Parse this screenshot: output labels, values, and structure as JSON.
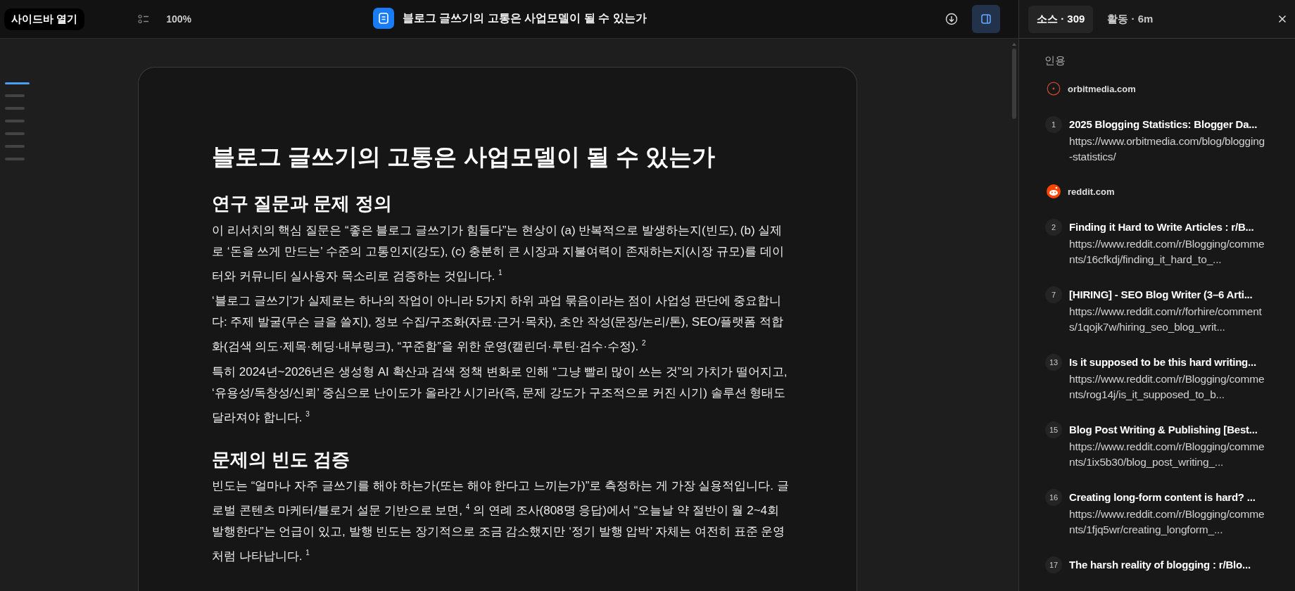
{
  "topbar": {
    "sidebar_button": "사이드바 열기",
    "zoom": "100%",
    "document_title": "블로그 글쓰기의 고통은 사업모델이 될 수 있는가",
    "panel_toggle": {
      "on": true
    }
  },
  "outline": [
    {
      "selected": true
    },
    {
      "selected": false
    },
    {
      "selected": false
    },
    {
      "selected": false
    },
    {
      "selected": false
    },
    {
      "selected": false
    },
    {
      "selected": false
    }
  ],
  "document": [
    {
      "kind": "title",
      "text": "블로그 글쓰기의 고통은 사업모델이 될 수 있는가"
    },
    {
      "kind": "heading",
      "text": "연구 질문과 문제 정의"
    },
    {
      "kind": "paragraph",
      "text": "이 리서치의 핵심 질문은 “좋은 블로그 글쓰기가 힘들다”는 현상이 (a) 반복적으로 발생하는지(빈도), (b) 실제로 ‘돈을 쓰게 만드는’ 수준의 고통인지(강도), (c) 충분히 큰 시장과 지불여력이 존재하는지(시장 규모)를 데이터와 커뮤니티 실사용자 목소리로 검증하는 것입니다. $^{1}$"
    },
    {
      "kind": "paragraph",
      "text": "‘블로그 글쓰기’가 실제로는 하나의 작업이 아니라 5가지 하위 과업 묶음이라는 점이 사업성 판단에 중요합니다: 주제 발굴(무슨 글을 쓸지), 정보 수집/구조화(자료·근거·목차), 초안 작성(문장/논리/톤), SEO/플랫폼 적합화(검색 의도·제목·헤딩·내부링크), “꾸준함”을 위한 운영(캘린더·루틴·검수·수정). $^{2}$"
    },
    {
      "kind": "paragraph",
      "text": "특히 2024년~2026년은 생성형 AI 확산과 검색 정책 변화로 인해 “그냥 빨리 많이 쓰는 것”의 가치가 떨어지고, ‘유용성/독창성/신뢰’ 중심으로 난이도가 올라간 시기라(즉, 문제 강도가 구조적으로 커진 시기) 솔루션 형태도 달라져야 합니다. $^{3}$"
    },
    {
      "kind": "heading",
      "text": "문제의 빈도 검증"
    },
    {
      "kind": "paragraph",
      "text": "빈도는 “얼마나 자주 글쓰기를 해야 하는가(또는 해야 한다고 느끼는가)”로 측정하는 게 가장 실용적입니다. 글로벌 콘텐츠 마케터/블로거 설문 기반으로 보면, $^{4}$ 의 연례 조사(808명 응답)에서 “오늘날 약 절반이 월 2~4회 발행한다”는 언급이 있고, 발행 빈도는 장기적으로 조금 감소했지만 ‘정기 발행 압박’ 자체는 여전히 표준 운영처럼 나타납니다. $^{1}$"
    }
  ],
  "panel": {
    "tabs": [
      {
        "label": "소스 · 309",
        "selected": true
      },
      {
        "label": "활동 · 6m",
        "selected": false
      }
    ],
    "section_label": "인용",
    "groups": [
      {
        "domain": "orbitmedia.com",
        "kind": "orbit",
        "citations": [
          {
            "number": "1",
            "title": "2025 Blogging Statistics: Blogger Da...",
            "url": "https://www.orbitmedia.com/blog/blogging-statistics/"
          }
        ]
      },
      {
        "domain": "reddit.com",
        "kind": "reddit",
        "citations": [
          {
            "number": "2",
            "title": "Finding it Hard to Write Articles : r/B...",
            "url": "https://www.reddit.com/r/Blogging/comments/16cfkdj/finding_it_hard_to_..."
          },
          {
            "number": "7",
            "title": "[HIRING] - SEO Blog Writer (3–6 Arti...",
            "url": "https://www.reddit.com/r/forhire/comments/1qojk7w/hiring_seo_blog_writ..."
          },
          {
            "number": "13",
            "title": "Is it supposed to be this hard writing...",
            "url": "https://www.reddit.com/r/Blogging/comments/rog14j/is_it_supposed_to_b..."
          },
          {
            "number": "15",
            "title": "Blog Post Writing & Publishing [Best...",
            "url": "https://www.reddit.com/r/Blogging/comments/1ix5b30/blog_post_writing_..."
          },
          {
            "number": "16",
            "title": "Creating long-form content is hard? ...",
            "url": "https://www.reddit.com/r/Blogging/comments/1fjq5wr/creating_longform_..."
          },
          {
            "number": "17",
            "title": "The harsh reality of blogging : r/Blo..."
          }
        ]
      }
    ]
  }
}
